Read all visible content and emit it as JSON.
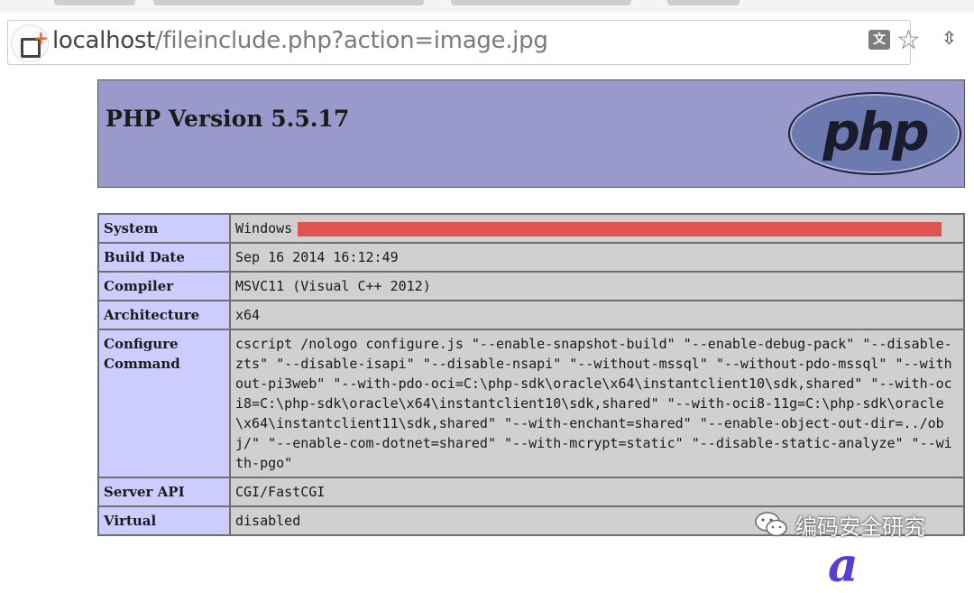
{
  "browser": {
    "url_host": "localhost",
    "url_path": "/fileinclude.php?action=image.jpg",
    "icons": [
      "page-icon",
      "translate-icon",
      "star-icon",
      "extension-icon"
    ]
  },
  "phpinfo": {
    "title": "PHP Version 5.5.17",
    "logo_text": "php",
    "rows": [
      {
        "key": "System",
        "value": "Windows"
      },
      {
        "key": "Build Date",
        "value": "Sep 16 2014 16:12:49"
      },
      {
        "key": "Compiler",
        "value": "MSVC11 (Visual C++ 2012)"
      },
      {
        "key": "Architecture",
        "value": "x64"
      },
      {
        "key": "Configure Command",
        "value": "cscript /nologo configure.js \"--enable-snapshot-build\" \"--enable-debug-pack\" \"--disable-zts\" \"--disable-isapi\" \"--disable-nsapi\" \"--without-mssql\" \"--without-pdo-mssql\" \"--without-pi3web\" \"--with-pdo-oci=C:\\php-sdk\\oracle\\x64\\instantclient10\\sdk,shared\" \"--with-oci8=C:\\php-sdk\\oracle\\x64\\instantclient10\\sdk,shared\" \"--with-oci8-11g=C:\\php-sdk\\oracle\\x64\\instantclient11\\sdk,shared\" \"--with-enchant=shared\" \"--enable-object-out-dir=../obj/\" \"--enable-com-dotnet=shared\" \"--with-mcrypt=static\" \"--disable-static-analyze\" \"--with-pgo\""
      },
      {
        "key": "Server API",
        "value": "CGI/FastCGI"
      },
      {
        "key": "Virtual",
        "value": "disabled"
      }
    ]
  },
  "watermark": {
    "text": "编码安全研究"
  },
  "colors": {
    "header_bg": "#9999cc",
    "key_bg": "#ccccff",
    "value_bg": "#d0d0d0",
    "redaction": "#e05353"
  }
}
